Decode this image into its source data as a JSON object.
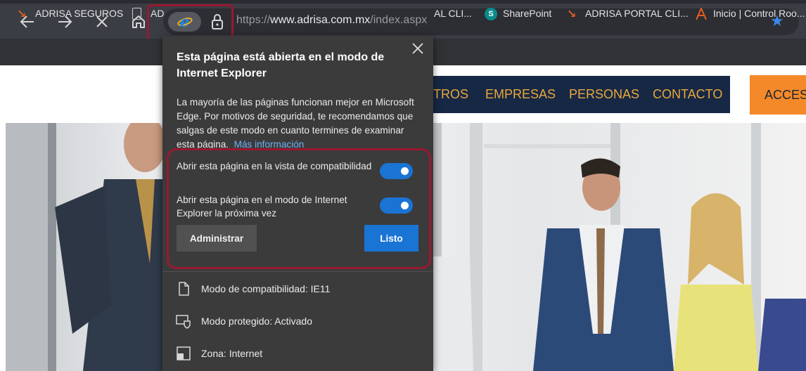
{
  "browser": {
    "nav": {
      "back": "back-icon",
      "forward": "forward-icon",
      "stop": "close-icon",
      "home": "home-icon"
    },
    "address": {
      "url_prefix": "https://",
      "url_domain": "www.adrisa.com.mx",
      "url_path": "/index.aspx",
      "ie_mode_icon": "internet-explorer-icon",
      "lock_icon": "lock-icon",
      "favorite_icon": "star-icon"
    },
    "bookmarks": [
      {
        "label": "ADRISA SEGUROS",
        "icon": "arrow-logo-icon"
      },
      {
        "label": "AD",
        "icon": "page-icon"
      },
      {
        "label": "AL CLI...",
        "icon": ""
      },
      {
        "label": "SharePoint",
        "icon": "sharepoint-icon"
      },
      {
        "label": "ADRISA PORTAL CLI...",
        "icon": "arrow-logo-icon"
      },
      {
        "label": "Inicio | Control Roo...",
        "icon": "control-room-icon"
      }
    ]
  },
  "site": {
    "nav": [
      "TROS",
      "EMPRESAS",
      "PERSONAS",
      "CONTACTO"
    ],
    "acceso": "ACCESO",
    "colors": {
      "nav_bg": "#172845",
      "nav_text": "#e9a83b",
      "acceso_bg": "#f4892a"
    }
  },
  "flyout": {
    "title": "Esta página está abierta en el modo de Internet Explorer",
    "body": "La mayoría de las páginas funcionan mejor en Microsoft Edge. Por motivos de seguridad, te recomendamos que salgas de este modo en cuanto termines de examinar esta página.",
    "link": "Más información",
    "options": [
      {
        "label": "Abrir esta página en la vista de compatibilidad",
        "enabled": true
      },
      {
        "label": "Abrir esta página en el modo de Internet Explorer la próxima vez",
        "enabled": true
      }
    ],
    "manage_button": "Administrar",
    "done_button": "Listo",
    "info": [
      {
        "icon": "document-icon",
        "text": "Modo de compatibilidad: IE11"
      },
      {
        "icon": "shield-window-icon",
        "text": "Modo protegido: Activado"
      },
      {
        "icon": "zone-icon",
        "text": "Zona: Internet"
      }
    ],
    "colors": {
      "accent": "#1a74d4",
      "highlight": "#9b1830",
      "panel": "#3b3b3b"
    }
  }
}
